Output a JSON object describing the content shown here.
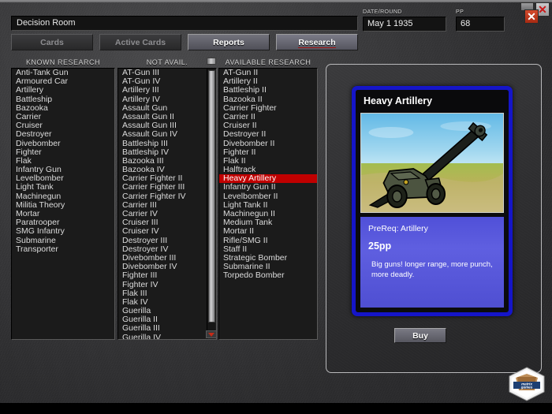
{
  "window": {
    "title": "Decision Room",
    "controls": [
      {
        "name": "minimize-button",
        "glyph": "–"
      },
      {
        "name": "close-button",
        "glyph": "✕"
      },
      {
        "name": "close-button-secondary",
        "glyph": "✕"
      }
    ]
  },
  "header": {
    "date_label": "DATE/ROUND",
    "date_value": "May 1 1935",
    "pp_label": "PP",
    "pp_value": "68"
  },
  "tabs": [
    {
      "label": "Cards",
      "state": "disabled"
    },
    {
      "label": "Active Cards",
      "state": "disabled"
    },
    {
      "label": "Reports",
      "state": "enabled"
    },
    {
      "label": "Research",
      "state": "active"
    }
  ],
  "columns": {
    "known": {
      "title": "KNOWN RESEARCH",
      "items": [
        "Anti-Tank Gun",
        "Armoured Car",
        "Artillery",
        "Battleship",
        "Bazooka",
        "Carrier",
        "Cruiser",
        "Destroyer",
        "Divebomber",
        "Fighter",
        "Flak",
        "Infantry Gun",
        "Levelbomber",
        "Light Tank",
        "Machinegun",
        "Militia Theory",
        "Mortar",
        "Paratrooper",
        "SMG Infantry",
        "Submarine",
        "Transporter"
      ]
    },
    "not_available": {
      "title": "NOT AVAIL.",
      "items": [
        "AT-Gun III",
        "AT-Gun IV",
        "Artillery III",
        "Artillery IV",
        "Assault Gun",
        "Assault Gun II",
        "Assault Gun III",
        "Assault Gun IV",
        "Battleship III",
        "Battleship IV",
        "Bazooka III",
        "Bazooka IV",
        "Carrier Fighter II",
        "Carrier Fighter III",
        "Carrier Fighter IV",
        "Carrier III",
        "Carrier IV",
        "Cruiser III",
        "Cruiser IV",
        "Destroyer III",
        "Destroyer IV",
        "Divebomber III",
        "Divebomber IV",
        "Fighter III",
        "Fighter IV",
        "Flak III",
        "Flak IV",
        "Guerilla",
        "Guerilla II",
        "Guerilla III",
        "Guerilla IV"
      ]
    },
    "available": {
      "title": "AVAILABLE RESEARCH",
      "selected": "Heavy Artillery",
      "items": [
        "AT-Gun II",
        "Artillery II",
        "Battleship II",
        "Bazooka II",
        "Carrier Fighter",
        "Carrier II",
        "Cruiser II",
        "Destroyer II",
        "Divebomber II",
        "Fighter II",
        "Flak II",
        "Halftrack",
        "Heavy Artillery",
        "Infantry Gun II",
        "Levelbomber II",
        "Light Tank II",
        "Machinegun II",
        "Medium Tank",
        "Mortar II",
        "Rifle/SMG II",
        "Staff II",
        "Strategic Bomber",
        "Submarine II",
        "Torpedo Bomber"
      ]
    }
  },
  "card": {
    "title": "Heavy Artillery",
    "art_name": "artillery-gun-illustration",
    "prereq": "PreReq: Artillery",
    "cost": "25pp",
    "description": "Big guns! longer range, more punch, more deadly."
  },
  "buy_button": {
    "label": "Buy"
  },
  "branding": {
    "logo_text": "matrix games"
  },
  "colors": {
    "selection_red": "#c00000",
    "card_border_blue": "#1515c8",
    "card_body_blue": "#5f5fe0",
    "panel_gray": "#313133"
  }
}
